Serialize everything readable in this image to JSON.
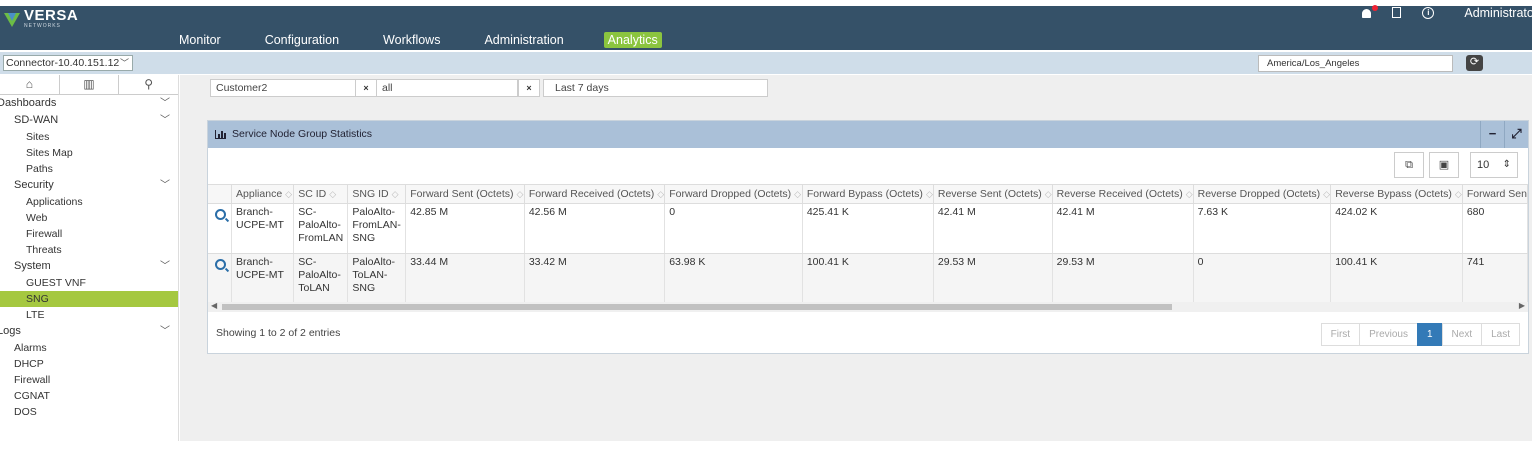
{
  "brand": {
    "name": "VERSA",
    "sub": "NETWORKS"
  },
  "nav": [
    "Monitor",
    "Configuration",
    "Workflows",
    "Administration",
    "Analytics"
  ],
  "nav_active": "Analytics",
  "top_right": {
    "user": "Administrator"
  },
  "appliance_selector": "Connector-10.40.151.12",
  "timezone": "America/Los_Angeles",
  "sidebar": {
    "tabs": [
      "home-icon",
      "chart-icon",
      "user-settings-icon"
    ],
    "dashboards_label": "Dashboards",
    "sdwan_label": "SD-WAN",
    "sdwan_items": [
      "Sites",
      "Sites Map",
      "Paths"
    ],
    "security_label": "Security",
    "security_items": [
      "Applications",
      "Web",
      "Firewall",
      "Threats"
    ],
    "system_label": "System",
    "system_items": [
      "GUEST VNF",
      "SNG",
      "LTE"
    ],
    "logs_label": "Logs",
    "logs_items": [
      "Alarms",
      "DHCP",
      "Firewall",
      "CGNAT",
      "DOS"
    ]
  },
  "filters": {
    "tenant": "Customer2",
    "scope": "all",
    "range": "Last 7 days",
    "clear": "×"
  },
  "panel": {
    "title": "Service Node Group Statistics",
    "minimize": "−",
    "page_size": "10",
    "columns": [
      "Appliance",
      "SC ID",
      "SNG ID",
      "Forward Sent (Octets)",
      "Forward Received (Octets)",
      "Forward Dropped (Octets)",
      "Forward Bypass (Octets)",
      "Reverse Sent (Octets)",
      "Reverse Received (Octets)",
      "Reverse Dropped (Octets)",
      "Reverse Bypass (Octets)",
      "Forward Sen"
    ],
    "rows": [
      [
        "Branch-UCPE-MT",
        "SC-PaloAlto-FromLAN",
        "PaloAlto-FromLAN-SNG",
        "42.85 M",
        "42.56 M",
        "0",
        "425.41 K",
        "42.41 M",
        "42.41 M",
        "7.63 K",
        "424.02 K",
        "680"
      ],
      [
        "Branch-UCPE-MT",
        "SC-PaloAlto-ToLAN",
        "PaloAlto-ToLAN-SNG",
        "33.44 M",
        "33.42 M",
        "63.98 K",
        "100.41 K",
        "29.53 M",
        "29.53 M",
        "0",
        "100.41 K",
        "741"
      ]
    ],
    "showing": "Showing 1 to 2 of 2 entries",
    "pager": {
      "first": "First",
      "previous": "Previous",
      "current": "1",
      "next": "Next",
      "last": "Last"
    }
  }
}
